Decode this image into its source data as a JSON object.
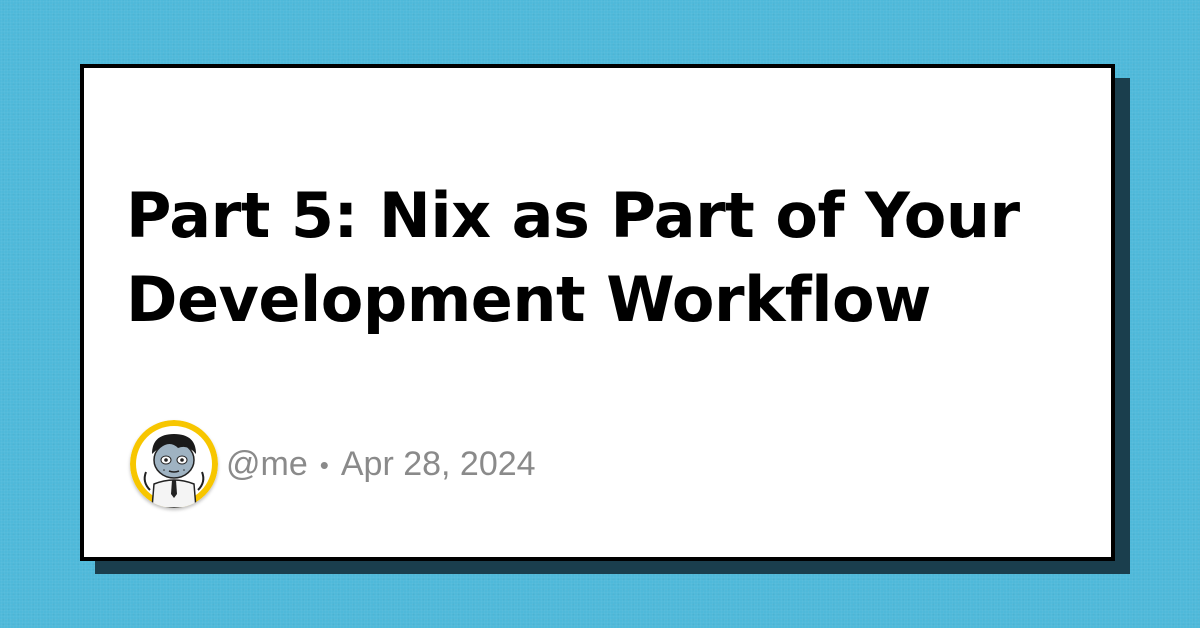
{
  "post": {
    "title": "Part 5: Nix as Part of Your Development Workflow",
    "author_handle": "@me",
    "separator": "•",
    "date": "Apr 28, 2024"
  },
  "avatar": {
    "icon": "cartoon-avatar-icon"
  },
  "colors": {
    "background": "#4fb9da",
    "card": "#ffffff",
    "card_border": "#000000",
    "card_shadow": "#1a3e4d",
    "title": "#000000",
    "byline": "#8a8a8a",
    "avatar_ring": "#f7c600"
  }
}
